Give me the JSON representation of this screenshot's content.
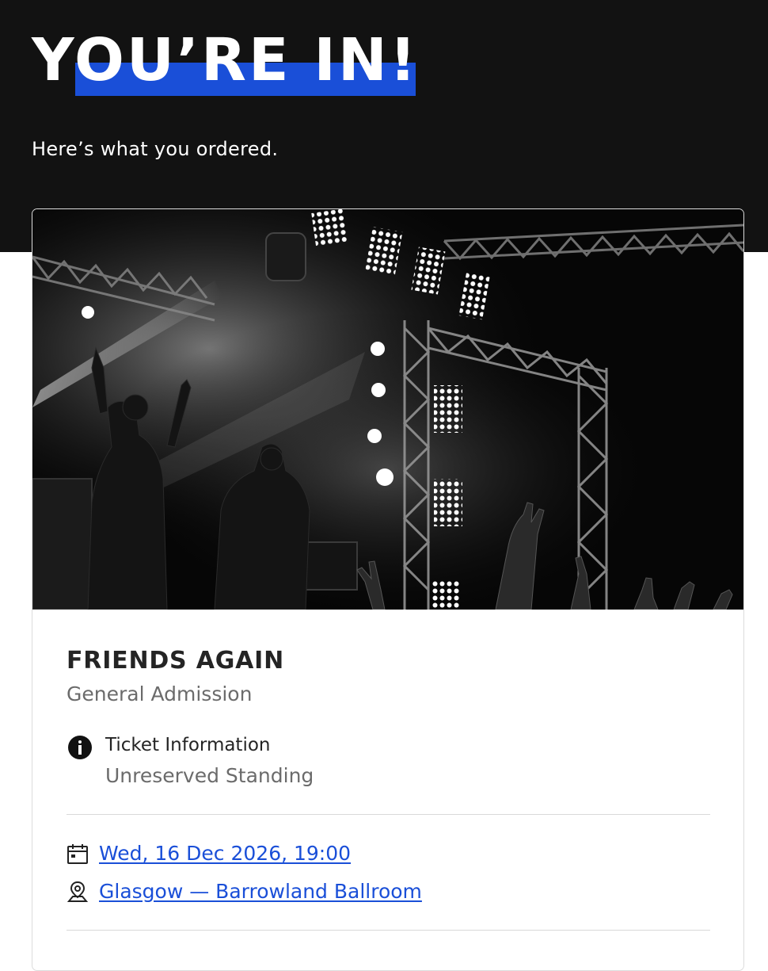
{
  "header": {
    "headline": "YOU’RE IN!",
    "subhead": "Here’s what you ordered."
  },
  "colors": {
    "accent": "#1a4fd8",
    "header_background": "#121212"
  },
  "event": {
    "image": "concert-stage-photo",
    "title": "FRIENDS AGAIN",
    "ticket_type": "General Admission",
    "ticket_info": {
      "icon": "info-icon",
      "heading": "Ticket Information",
      "value": "Unreserved Standing"
    },
    "date": {
      "icon": "calendar-icon",
      "text": "Wed, 16 Dec 2026, 19:00"
    },
    "venue": {
      "icon": "location-pin-icon",
      "text": "Glasgow — Barrowland Ballroom"
    }
  }
}
